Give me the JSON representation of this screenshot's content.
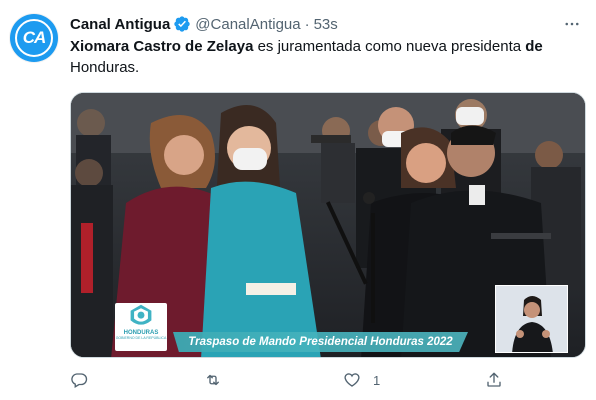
{
  "tweet": {
    "avatar_text": "CA",
    "display_name": "Canal Antigua",
    "handle": "@CanalAntigua",
    "separator": "·",
    "time": "53s",
    "text_bold_1": "Xiomara Castro de Zelaya",
    "text_1": " es juramentada como nueva presidenta ",
    "text_bold_2": "de",
    "text_2": "Honduras.",
    "media": {
      "banner_text": "Traspaso de Mando Presidencial Honduras 2022",
      "logo_text": "HONDURAS",
      "logo_sub": "GOBIERNO DE LA REPÚBLICA"
    },
    "actions": {
      "reply_icon": "reply-icon",
      "retweet_icon": "retweet-icon",
      "like_icon": "heart-icon",
      "like_count": "1",
      "share_icon": "share-icon"
    }
  },
  "colors": {
    "accent": "#1d9bf0",
    "secondary_text": "#536471",
    "primary_text": "#0f1419",
    "banner": "#3aaab4"
  }
}
